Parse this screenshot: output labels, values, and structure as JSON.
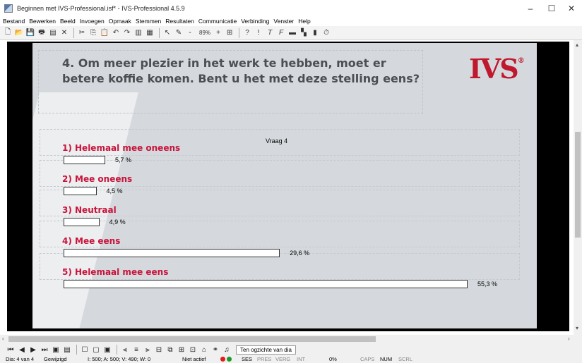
{
  "window": {
    "title": "Beginnen met IVS-Professional.isf* - IVS-Professional 4.5.9"
  },
  "menu": [
    "Bestand",
    "Bewerken",
    "Beeld",
    "Invoegen",
    "Opmaak",
    "Stemmen",
    "Resultaten",
    "Communicatie",
    "Verbinding",
    "Venster",
    "Help"
  ],
  "toolbar": {
    "zoom": "89%"
  },
  "slide": {
    "question": "4. Om meer plezier in het werk te hebben, moet er betere koffie komen. Bent u het met deze stelling eens?",
    "logo_text": "IVS",
    "logo_mark": "®",
    "chart_data": {
      "type": "bar",
      "title": "Vraag 4",
      "categories": [
        "1) Helemaal mee oneens",
        "2) Mee oneens",
        "3) Neutraal",
        "4) Mee eens",
        "5) Helemaal mee eens"
      ],
      "values": [
        5.7,
        4.5,
        4.9,
        29.6,
        55.3
      ],
      "value_labels": [
        "5,7 %",
        "4,5 %",
        "4,9 %",
        "29,6 %",
        "55,3 %"
      ]
    }
  },
  "nav": {
    "overview_button": "Ten ogzichte van dia"
  },
  "status": {
    "slide": "Dia: 4 van 4",
    "modified": "Gewijzigd",
    "counts": "I: 500;  A: 500;  V: 490;  W: 0",
    "state": "Niet actief",
    "ses": "SES",
    "pres": "PRES",
    "verg": "VERG",
    "int": "INT",
    "percent": "0%",
    "caps": "CAPS",
    "num": "NUM",
    "scrl": "SCRL"
  }
}
